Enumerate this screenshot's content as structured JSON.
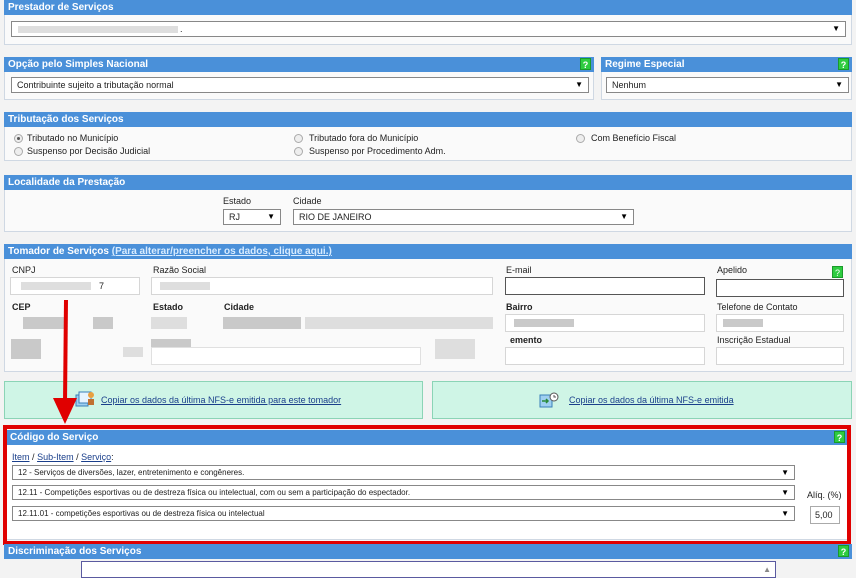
{
  "prestador": {
    "title": "Prestador de Serviços",
    "value": "."
  },
  "simples": {
    "title": "Opção pelo Simples Nacional",
    "value": "Contribuinte sujeito a tributação normal"
  },
  "regime": {
    "title": "Regime Especial",
    "value": "Nenhum"
  },
  "tributacao": {
    "title": "Tributação dos Serviços",
    "options": [
      {
        "label": "Tributado no Município",
        "checked": true
      },
      {
        "label": "Tributado fora do Município",
        "checked": false
      },
      {
        "label": "Com Benefício Fiscal",
        "checked": false
      },
      {
        "label": "Suspenso por Decisão Judicial",
        "checked": false
      },
      {
        "label": "Suspenso por Procedimento Adm.",
        "checked": false
      }
    ]
  },
  "localidade": {
    "title": "Localidade da Prestação",
    "estado_label": "Estado",
    "estado_value": "RJ",
    "cidade_label": "Cidade",
    "cidade_value": "RIO DE JANEIRO"
  },
  "tomador": {
    "title": "Tomador de Serviços",
    "link": "(Para alterar/preencher os dados, clique aqui.)",
    "cnpj_label": "CNPJ",
    "cnpj_value": "7",
    "razao_label": "Razão Social",
    "email_label": "E-mail",
    "apelido_label": "Apelido",
    "cep_label": "CEP",
    "estado_label": "Estado",
    "cidade_label": "Cidade",
    "bairro_label": "Bairro",
    "telefone_label": "Telefone de Contato",
    "complemento_label": "emento",
    "ie_label": "Inscrição Estadual"
  },
  "copy": {
    "tomador_link": "Copiar os dados da última NFS-e emitida para este tomador",
    "ultima_link": "Copiar os dados da última NFS-e emitida"
  },
  "codigo": {
    "title": "Código do Serviço",
    "crumb_item": "Item",
    "crumb_sep": "/",
    "crumb_subitem": "Sub-Item",
    "crumb_servico": "Serviço",
    "crumb_colon": ":",
    "item_value": "12 - Serviços de diversões, lazer, entretenimento e congêneres.",
    "subitem_value": "12.11 - Competições esportivas ou de destreza física ou intelectual, com ou sem a participação do espectador.",
    "servico_value": "12.11.01 - competições esportivas ou de destreza física ou intelectual",
    "aliq_label": "Alíq. (%)",
    "aliq_value": "5,00"
  },
  "discriminacao": {
    "title": "Discriminação dos Serviços"
  },
  "help_mark": "?",
  "arrow_glyph": "▼",
  "colors": {
    "header": "#4a90d9",
    "highlight": "#e00000",
    "copy_bg": "#cff5e6",
    "help": "#2ecc40"
  }
}
